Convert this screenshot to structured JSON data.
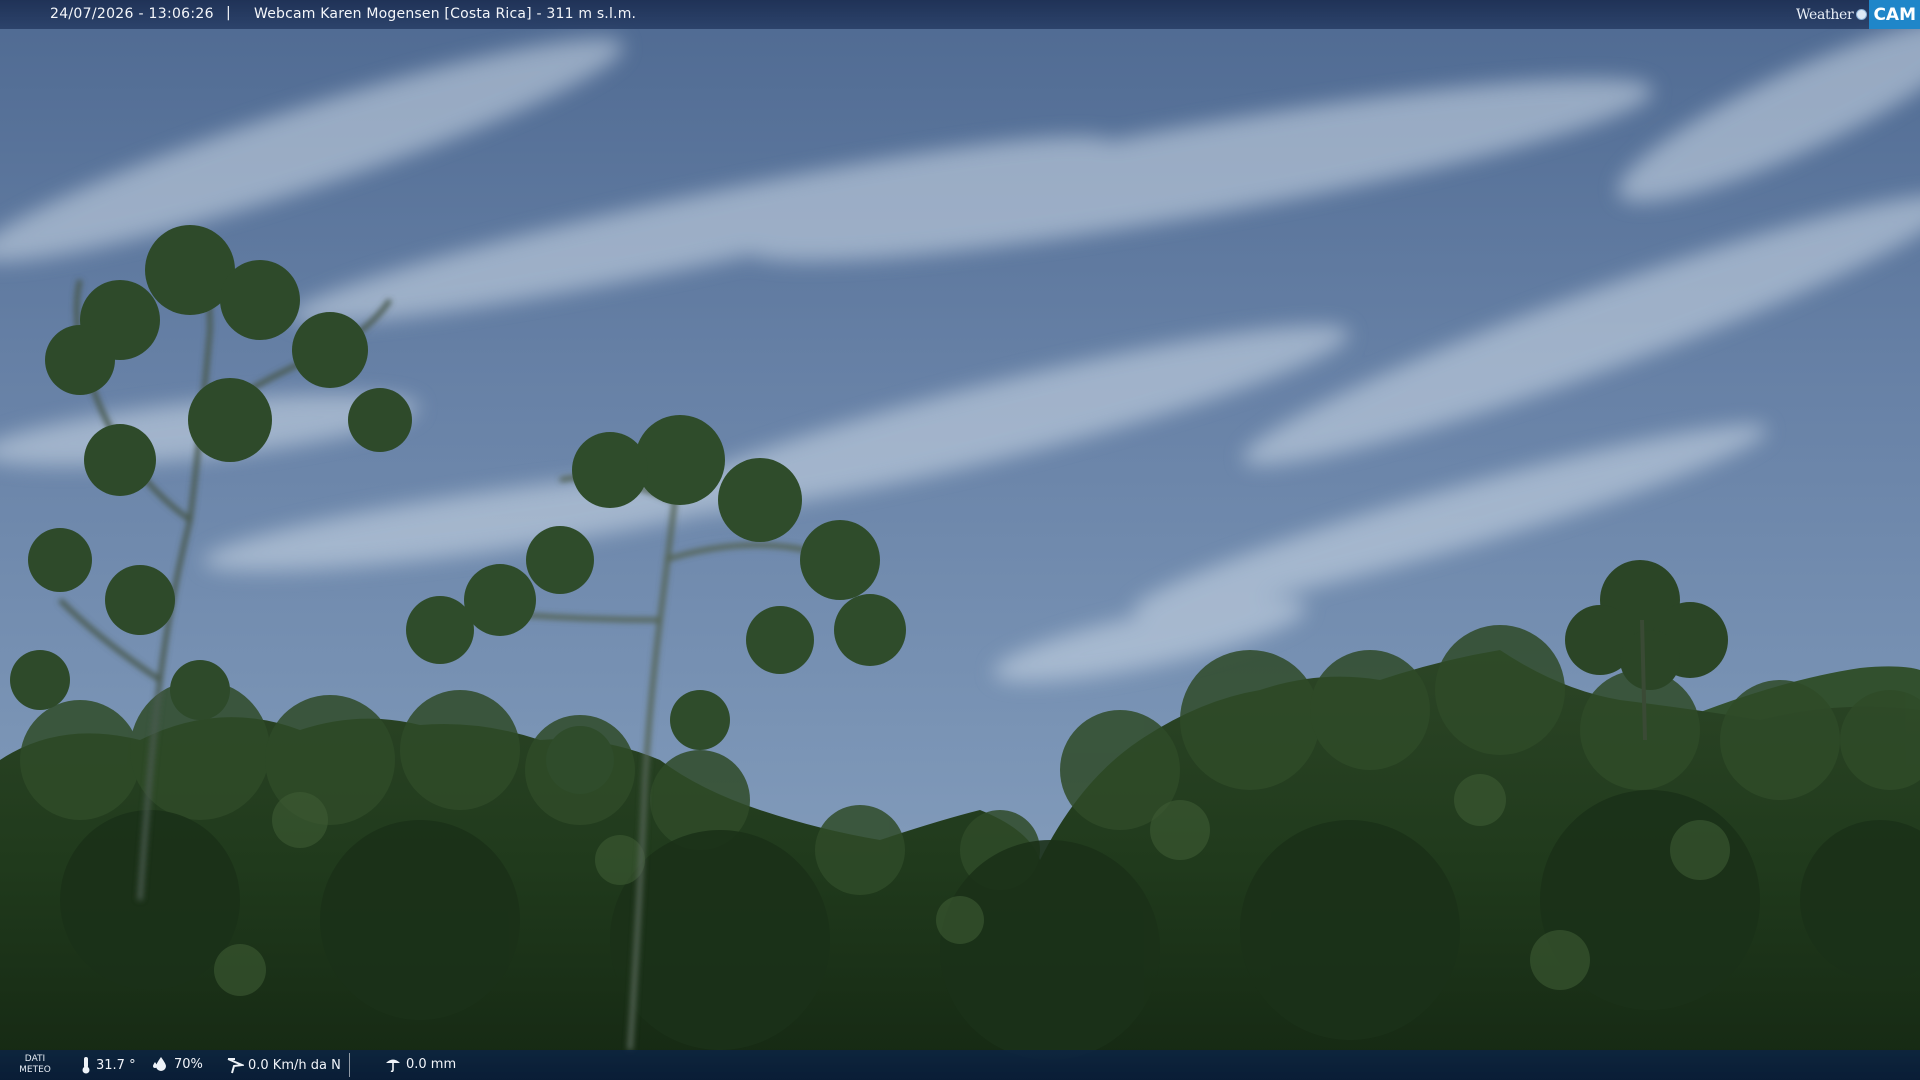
{
  "header": {
    "datetime": "24/07/2026 - 13:06:26",
    "separator": "|",
    "title": "Webcam Karen Mogensen [Costa Rica] - 311 m s.l.m."
  },
  "logo": {
    "weather": "Weather",
    "cam": "CAM"
  },
  "footer": {
    "dati_line1": "DATI",
    "dati_line2": "METEO",
    "temperature": "31.7 °",
    "humidity": "70%",
    "wind": "0.0 Km/h da N",
    "rain": "0.0 mm"
  },
  "icons": {
    "temperature": "thermometer-icon",
    "humidity": "humidity-drop-icon",
    "wind": "wind-icon",
    "rain": "rain-gauge-icon"
  },
  "colors": {
    "sky": "#6f89ad",
    "foliage": "#233a1f",
    "bar": "#1c3766",
    "logo_accent": "#1f86c9"
  }
}
